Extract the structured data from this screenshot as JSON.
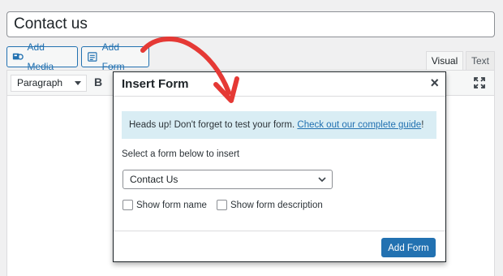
{
  "title_field": {
    "value": "Contact us"
  },
  "media_buttons": {
    "add_media": "Add Media",
    "add_form": "Add Form"
  },
  "editor_tabs": {
    "visual": "Visual",
    "text": "Text"
  },
  "toolbar": {
    "format_value": "Paragraph",
    "bold_label": "B"
  },
  "modal": {
    "title": "Insert Form",
    "close_symbol": "×",
    "notice_text": "Heads up! Don't forget to test your form. ",
    "notice_link": "Check out our complete guide",
    "notice_end": "!",
    "select_label": "Select a form below to insert",
    "selected_form": "Contact Us",
    "show_name_label": "Show form name",
    "show_description_label": "Show form description",
    "submit_label": "Add Form"
  },
  "colors": {
    "accent": "#2271b1",
    "notice_bg": "#d9edf4",
    "annotation_arrow": "#e53935"
  },
  "icons": [
    "add-media-icon",
    "add-form-icon",
    "fullscreen-icon",
    "chevron-down-icon",
    "close-icon"
  ]
}
